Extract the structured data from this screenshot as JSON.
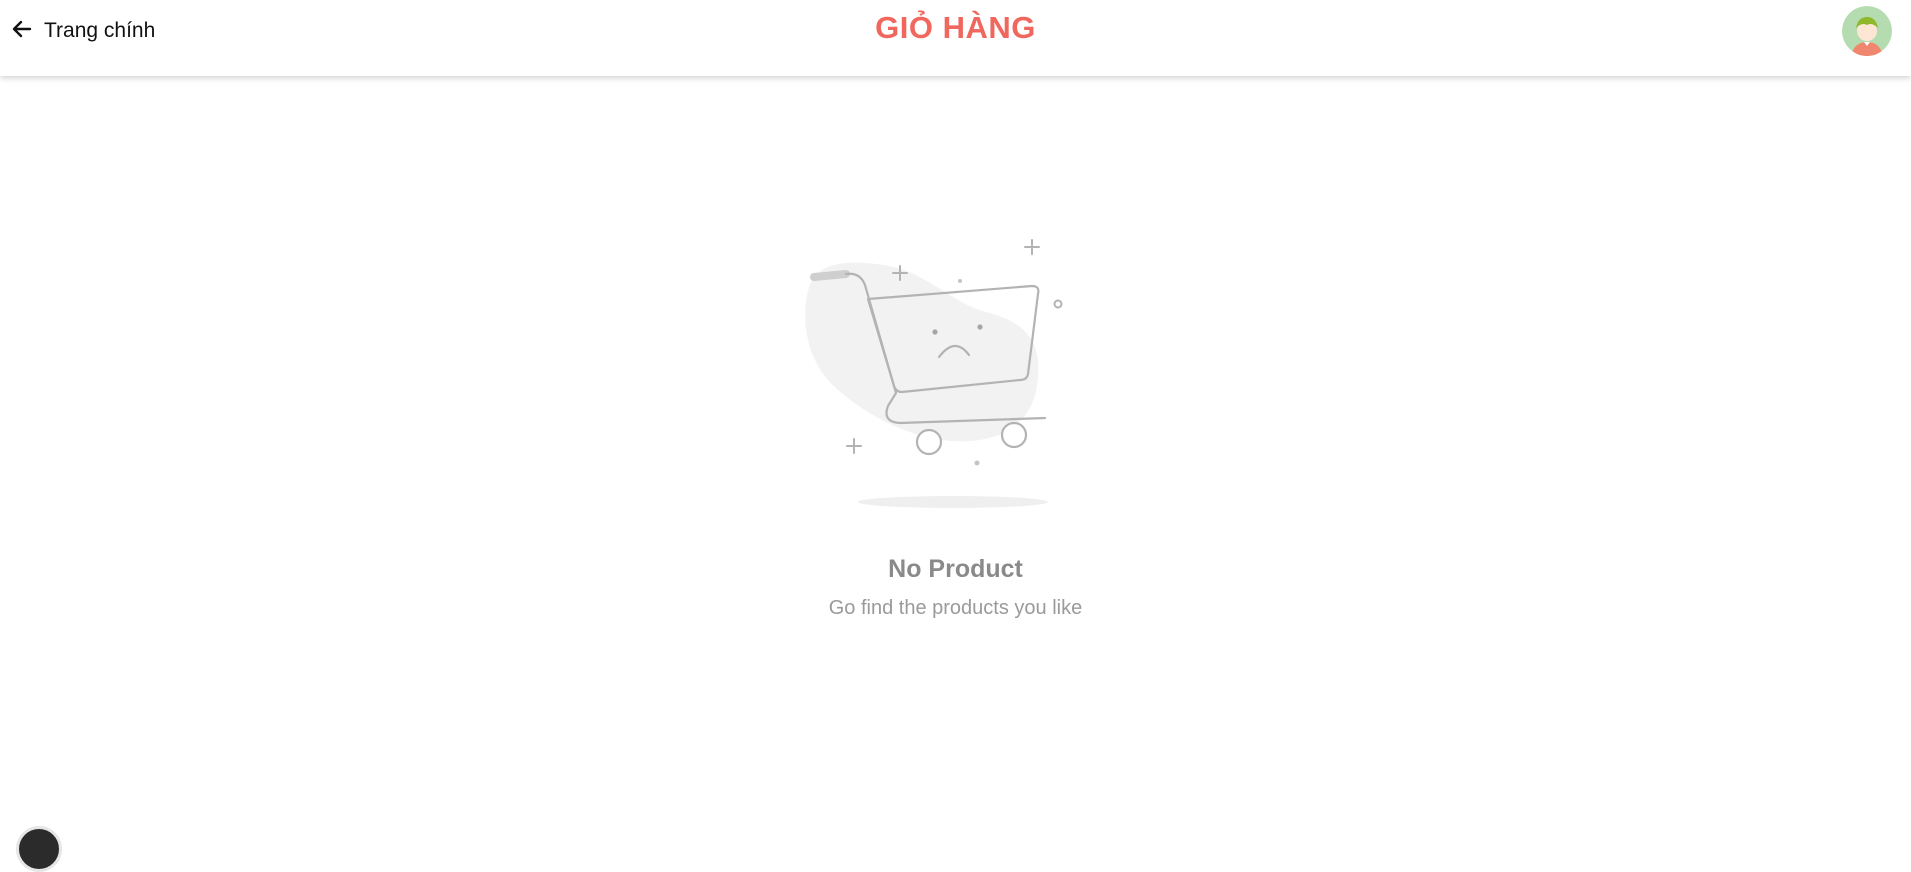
{
  "header": {
    "back_label": "Trang chính",
    "title": "GIỎ HÀNG",
    "title_color": "#f0675d",
    "avatar_icon": "user-avatar-icon"
  },
  "empty_state": {
    "illustration": "sad-shopping-cart-icon",
    "title": "No Product",
    "subtitle": "Go find the products you like"
  },
  "floating_button": {
    "icon": "chat-bubble-icon"
  }
}
